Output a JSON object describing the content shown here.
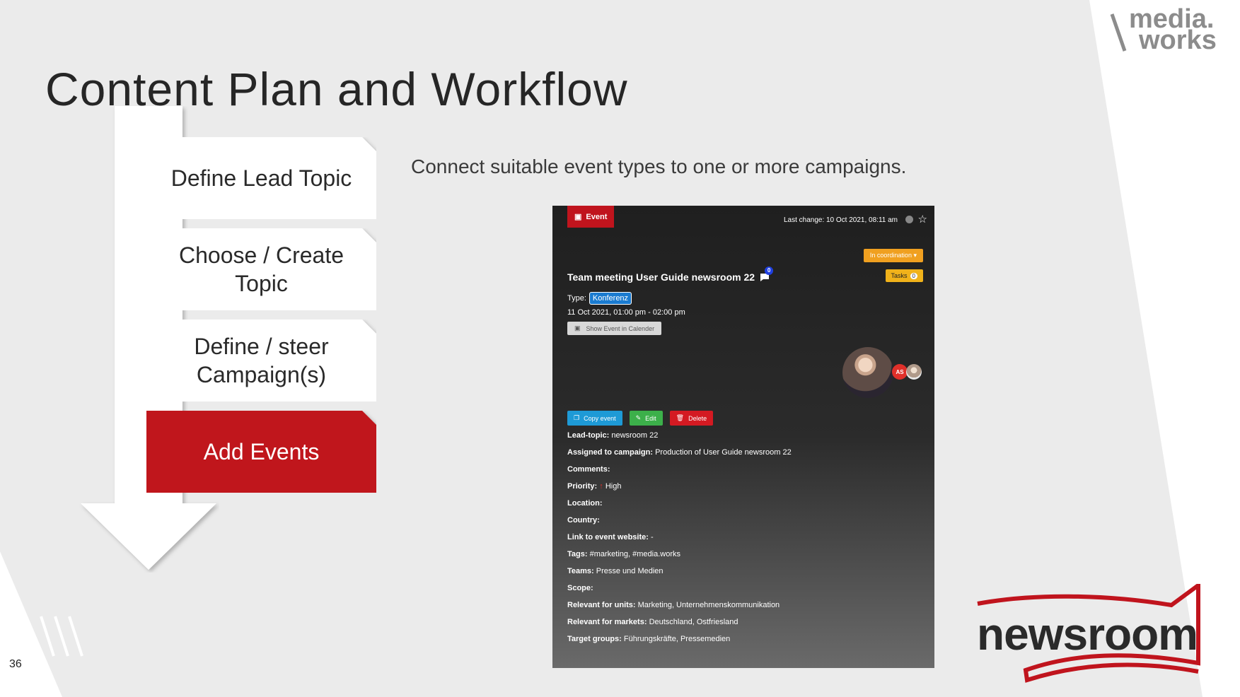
{
  "slide": {
    "title": "Content Plan and Workflow",
    "page_number": "36",
    "description": "Connect suitable event types to one or more campaigns."
  },
  "brand": {
    "mediaworks_line1": "media.",
    "mediaworks_line2": "works",
    "newsroom": "newsroom",
    "accent_color": "#c0141d"
  },
  "workflow": {
    "steps": [
      {
        "label": "Define Lead Topic"
      },
      {
        "label": "Choose / Create\nTopic"
      },
      {
        "label": "Define / steer\nCampaign(s)"
      },
      {
        "label": "Add Events",
        "active": true
      }
    ]
  },
  "event_panel": {
    "badge": "Event",
    "last_change": "Last change: 10 Oct 2021, 08:11 am",
    "status": "In coordination",
    "tasks_label": "Tasks",
    "tasks_count": "0",
    "title": "Team meeting User Guide newsroom 22",
    "comment_count": "0",
    "type_label": "Type:",
    "type_value": "Konferenz",
    "datetime": "11 Oct 2021, 01:00 pm - 02:00 pm",
    "calendar_button": "Show Event in Calender",
    "avatar_initials": "AS",
    "actions": {
      "copy": "Copy event",
      "edit": "Edit",
      "delete": "Delete"
    },
    "details": [
      {
        "label": "Lead-topic:",
        "value": "newsroom 22"
      },
      {
        "label": "Assigned to campaign:",
        "value": "Production of User Guide newsroom 22"
      },
      {
        "label": "Comments:",
        "value": ""
      },
      {
        "label": "Priority:",
        "value": "High"
      },
      {
        "label": "Location:",
        "value": ""
      },
      {
        "label": "Country:",
        "value": ""
      },
      {
        "label": "Link to event website:",
        "value": "-"
      },
      {
        "label": "Tags:",
        "value": "#marketing, #media.works"
      },
      {
        "label": "Teams:",
        "value": "Presse und Medien"
      },
      {
        "label": "Scope:",
        "value": ""
      },
      {
        "label": "Relevant for units:",
        "value": "Marketing, Unternehmenskommunikation"
      },
      {
        "label": "Relevant for markets:",
        "value": "Deutschland, Ostfriesland"
      },
      {
        "label": "Target groups:",
        "value": "Führungskräfte, Pressemedien"
      }
    ]
  }
}
